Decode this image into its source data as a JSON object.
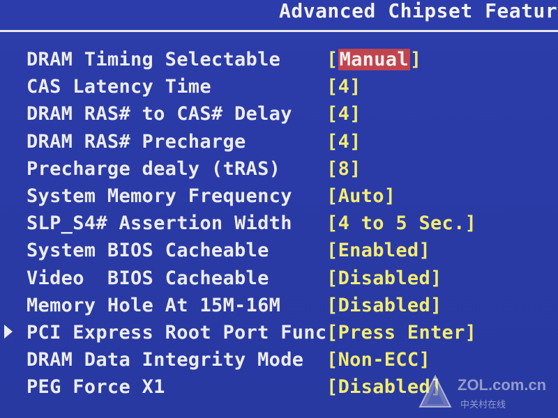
{
  "header": {
    "title": "Advanced Chipset Feature"
  },
  "items": [
    {
      "label": "DRAM Timing Selectable",
      "value": "Manual"
    },
    {
      "label": "CAS Latency Time",
      "value": "4"
    },
    {
      "label": "DRAM RAS# to CAS# Delay",
      "value": "4"
    },
    {
      "label": "DRAM RAS# Precharge",
      "value": "4"
    },
    {
      "label": "Precharge dealy (tRAS)",
      "value": "8"
    },
    {
      "label": "System Memory Frequency",
      "value": "Auto"
    },
    {
      "label": "SLP_S4# Assertion Width",
      "value": "4 to 5 Sec."
    },
    {
      "label": "System BIOS Cacheable",
      "value": "Enabled"
    },
    {
      "label": "Video  BIOS Cacheable",
      "value": "Disabled"
    },
    {
      "label": "Memory Hole At 15M-16M",
      "value": "Disabled"
    },
    {
      "label": "PCI Express Root Port Func",
      "value": "Press Enter"
    },
    {
      "label": "DRAM Data Integrity Mode",
      "value": "Non-ECC"
    },
    {
      "label": "PEG Force X1",
      "value": "Disabled"
    }
  ],
  "watermark": {
    "domain": "ZOL.com.cn",
    "cn_text": "中关村在线"
  },
  "colors": {
    "background": "#2a3aa6",
    "label": "#ececec",
    "value": "#f3ec70",
    "highlight": "#c0444e"
  },
  "icons": {
    "submenu_pointer": "triangle-right-icon",
    "watermark_logo": "zol-logo-icon"
  }
}
